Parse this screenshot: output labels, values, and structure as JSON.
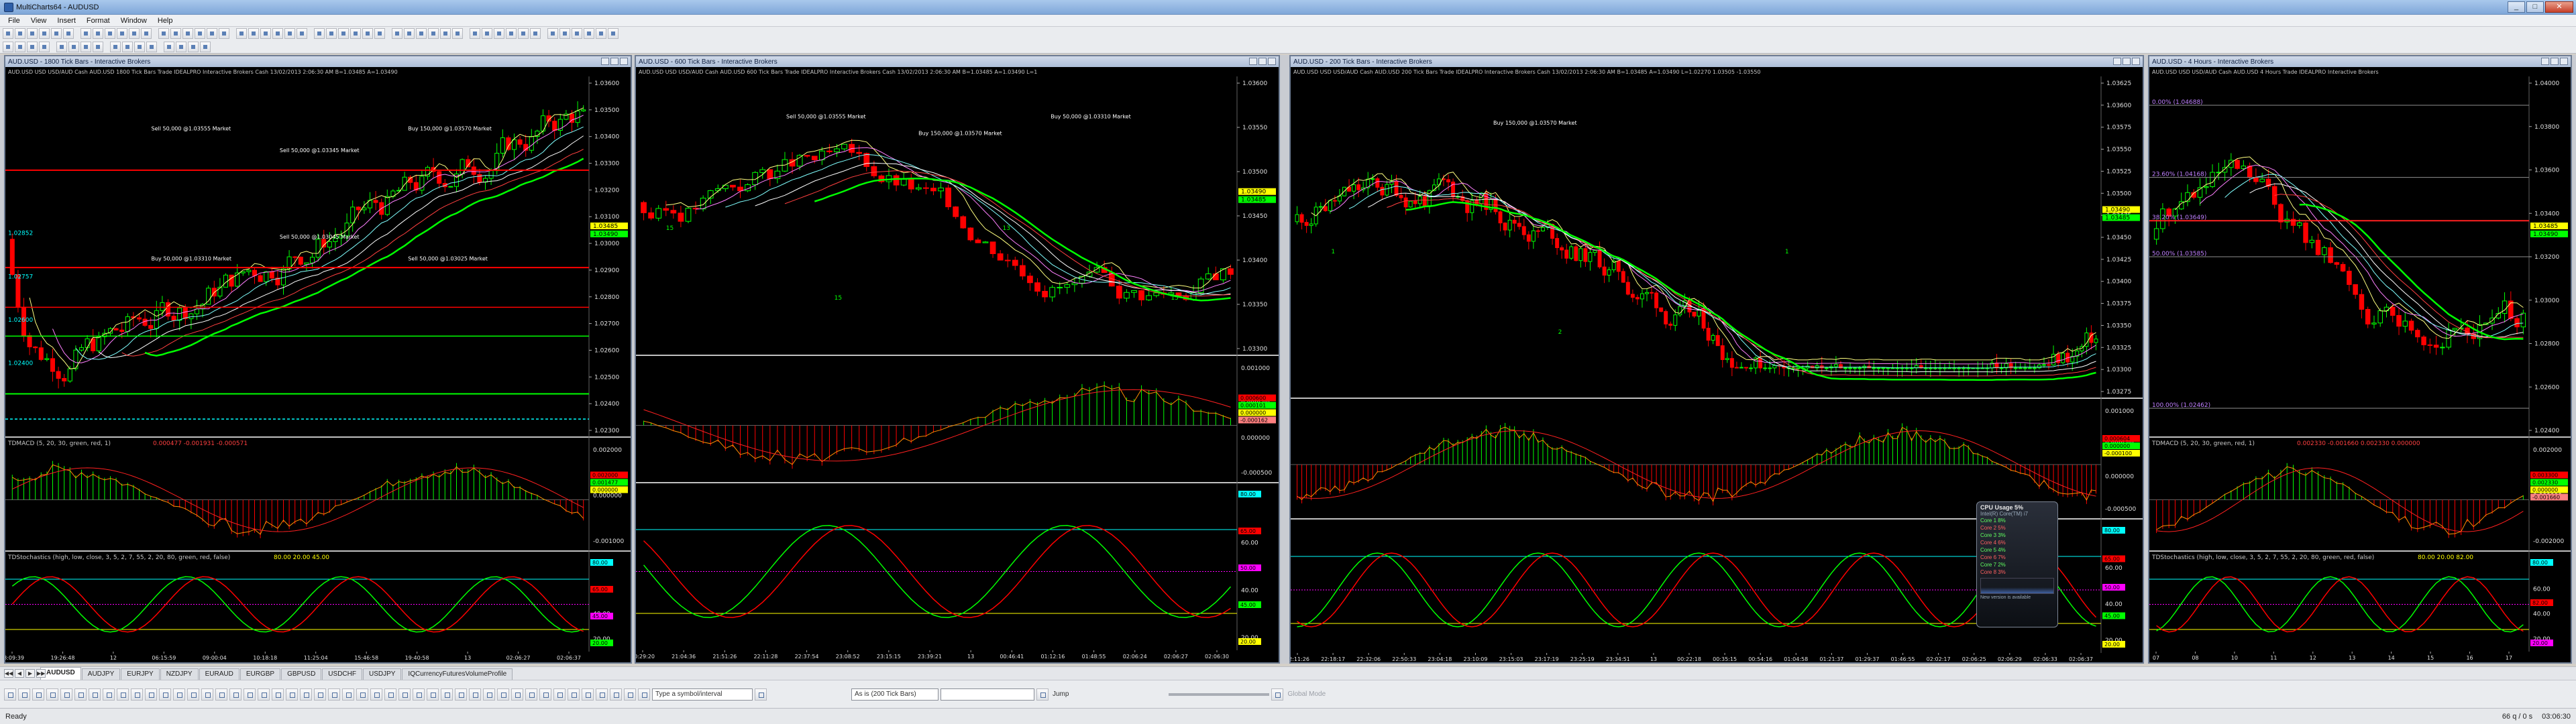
{
  "window": {
    "title": "MultiCharts64 - AUDUSD",
    "minimize": "_",
    "maximize": "□",
    "close": "✕"
  },
  "menu": [
    "File",
    "View",
    "Insert",
    "Format",
    "Window",
    "Help"
  ],
  "charts": [
    {
      "title": "AUD.USD - 1800 Tick Bars - Interactive Brokers",
      "status": "AUD.USD  USD USD/AUD Cash AUD.USD  1800 Tick Bars  Trade  IDEALPRO  Interactive Brokers  Cash  13/02/2013  2:06:30 AM  B=1.03485  A=1.03490",
      "price_ticks": [
        "1.03600",
        "1.03500",
        "1.03400",
        "1.03300",
        "1.03200",
        "1.03100",
        "1.03000",
        "1.02900",
        "1.02800",
        "1.02700",
        "1.02600",
        "1.02500",
        "1.02400",
        "1.02300"
      ],
      "price_badges": [
        "1.03485",
        "1.03490"
      ],
      "level_labels": [
        "1.02852",
        "1.02757",
        "1.02600",
        "1.02400"
      ],
      "trade_labels": [
        "Sell 50,000 @1.03555 Market",
        "Sell 50,000 @1.03345 Market",
        "Buy 150,000 @1.03570 Market",
        "Buy 50,000 @1.03310 Market",
        "Sell 50,000 @1.03045 Market",
        "Sell 50,000 @1.03025 Market"
      ],
      "macd_title": "TDMACD (5, 20, 30, green, red, 1)",
      "macd_values": "0.000477  -0.001931  -0.000571",
      "macd_ticks": [
        "0.002000",
        "0.000000",
        "-0.001000"
      ],
      "macd_badges": [
        "0.002000",
        "0.001477",
        "0.000000"
      ],
      "stoch_title": "TDStochastics (high, low, close, 3, 5, 2, 7, 55, 2, 20, 80, green, red, false)",
      "stoch_values": "80.00  20.00  45.00",
      "stoch_ticks": [
        "80.00",
        "60.00",
        "40.00",
        "20.00"
      ],
      "stoch_badges": [
        "80.00",
        "65.00",
        "45.00",
        "20.00"
      ],
      "time_ticks": [
        "18:09:39",
        "19:26:48",
        "12",
        "06:15:59",
        "09:00:04",
        "10:18:18",
        "11:25:04",
        "15:46:58",
        "19:40:58",
        "13",
        "02:06:27",
        "02:06:37"
      ]
    },
    {
      "title": "AUD.USD - 600 Tick Bars - Interactive Brokers",
      "status": "AUD.USD  USD USD/AUD Cash AUD.USD  600 Tick Bars  Trade  IDEALPRO  Interactive Brokers  Cash  13/02/2013  2:06:30 AM  B=1.03485  A=1.03490  L=1",
      "price_ticks": [
        "1.03600",
        "1.03550",
        "1.03500",
        "1.03450",
        "1.03400",
        "1.03350",
        "1.03300"
      ],
      "price_badges": [
        "1.03490",
        "1.03485"
      ],
      "trade_labels": [
        "Sell 50,000 @1.03555 Market",
        "Buy 150,000 @1.03570 Market",
        "Buy 50,000 @1.03310 Market"
      ],
      "bar_counts": [
        "15",
        "15",
        "13",
        "15"
      ],
      "macd_ticks": [
        "0.001000",
        "0.000500",
        "0.000000",
        "-0.000500"
      ],
      "macd_badges": [
        "0.000600",
        "0.000101",
        "0.000000",
        "-0.000162"
      ],
      "stoch_ticks": [
        "80.00",
        "60.00",
        "40.00",
        "20.00"
      ],
      "stoch_badges": [
        "80.00",
        "65.00",
        "50.00",
        "45.00",
        "20.00"
      ],
      "time_ticks": [
        "20:29:20",
        "21:04:36",
        "21:51:26",
        "22:11:28",
        "22:37:54",
        "23:08:52",
        "23:15:15",
        "23:39:21",
        "13",
        "00:46:41",
        "01:12:16",
        "01:48:55",
        "02:06:24",
        "02:06:27",
        "02:06:30"
      ]
    },
    {
      "title": "AUD.USD - 200 Tick Bars - Interactive Brokers",
      "status": "AUD.USD  USD USD/AUD Cash AUD.USD  200 Tick Bars  Trade  IDEALPRO  Interactive Brokers  Cash  13/02/2013  2:06:30 AM  B=1.03485  A=1.03490  L=1.02270  1.03505  -1.03550",
      "price_ticks": [
        "1.03625",
        "1.03600",
        "1.03575",
        "1.03550",
        "1.03525",
        "1.03500",
        "1.03475",
        "1.03450",
        "1.03425",
        "1.03400",
        "1.03375",
        "1.03350",
        "1.03325",
        "1.03300",
        "1.03275"
      ],
      "price_badges": [
        "1.03490",
        "1.03485"
      ],
      "trade_labels": [
        "Buy 150,000 @1.03570 Market"
      ],
      "bar_counts": [
        "1",
        "2",
        "1"
      ],
      "macd_ticks": [
        "0.001000",
        "0.000500",
        "0.000000",
        "-0.000500"
      ],
      "macd_badges": [
        "0.000604",
        "0.000000",
        "-0.000100"
      ],
      "stoch_ticks": [
        "80.00",
        "60.00",
        "40.00",
        "20.00"
      ],
      "stoch_badges": [
        "80.00",
        "65.00",
        "50.00",
        "45.00",
        "20.00"
      ],
      "time_ticks": [
        "22:11:26",
        "22:18:17",
        "22:32:06",
        "22:50:33",
        "23:04:18",
        "23:10:09",
        "23:15:03",
        "23:17:19",
        "23:25:19",
        "23:34:51",
        "13",
        "00:22:18",
        "00:35:15",
        "00:54:16",
        "01:04:58",
        "01:21:37",
        "01:29:37",
        "01:46:55",
        "02:02:17",
        "02:06:25",
        "02:06:29",
        "02:06:33",
        "02:06:37"
      ]
    },
    {
      "title": "AUD.USD - 4 Hours - Interactive Brokers",
      "status": "AUD.USD  USD USD/AUD Cash AUD.USD  4 Hours  Trade  IDEALPRO  Interactive Brokers",
      "price_ticks": [
        "1.04000",
        "1.03800",
        "1.03600",
        "1.03400",
        "1.03200",
        "1.03000",
        "1.02800",
        "1.02600",
        "1.02400"
      ],
      "price_badges": [
        "1.03485",
        "1.03490"
      ],
      "fib_labels": [
        "0.00% (1.04688)",
        "23.60% (1.04168)",
        "38.20% (1.03649)",
        "50.00% (1.03585)",
        "100.00% (1.02462)"
      ],
      "macd_title": "TDMACD (5, 20, 30, green, red, 1)",
      "macd_values": "0.002330  -0.001660  0.002330  0.000000",
      "macd_ticks": [
        "0.002000",
        "0.000000",
        "-0.002000"
      ],
      "macd_badges": [
        "0.003300",
        "0.002330",
        "0.000000",
        "-0.001660"
      ],
      "stoch_title": "TDStochastics (high, low, close, 3, 5, 2, 7, 55, 2, 20, 80, green, red, false)",
      "stoch_values": "80.00  20.00  82.00",
      "stoch_ticks": [
        "80.00",
        "60.00",
        "40.00",
        "20.00"
      ],
      "stoch_badges": [
        "80.00",
        "82.00",
        "20.00"
      ],
      "time_ticks": [
        "07",
        "08",
        "10",
        "11",
        "12",
        "13",
        "14",
        "15",
        "16",
        "17"
      ]
    }
  ],
  "cpu_gadget": {
    "title": "CPU Usage",
    "total": "5%",
    "model": "Intel(R) Core(TM) i7",
    "rows": [
      "Core 1  8%",
      "Core 2  5%",
      "Core 3  3%",
      "Core 4  6%",
      "Core 5  4%",
      "Core 6  7%",
      "Core 7  2%",
      "Core 8  3%"
    ],
    "footer": "New version is available"
  },
  "tabs": [
    "AUDUSD",
    "AUDJPY",
    "EURJPY",
    "NZDJPY",
    "EURAUD",
    "EURGBP",
    "GBPUSD",
    "USDCHF",
    "USDJPY",
    "IQCurrencyFuturesVolumeProfile"
  ],
  "tab_nav": [
    "◀◀",
    "◀",
    "▶",
    "▶▶"
  ],
  "drawbar": {
    "symbol_placeholder": "Type a symbol/interval",
    "interval_value": "As is (200 Tick Bars)",
    "jump_label": "Jump",
    "global_mode_label": "Global Mode"
  },
  "status": {
    "left": "Ready",
    "net": "66 q / 0 s",
    "time": "03:06:30"
  },
  "colors": {
    "up": "#ff0000",
    "down": "#00ff00",
    "bg": "#000000",
    "accent": "#2e5fa8"
  }
}
